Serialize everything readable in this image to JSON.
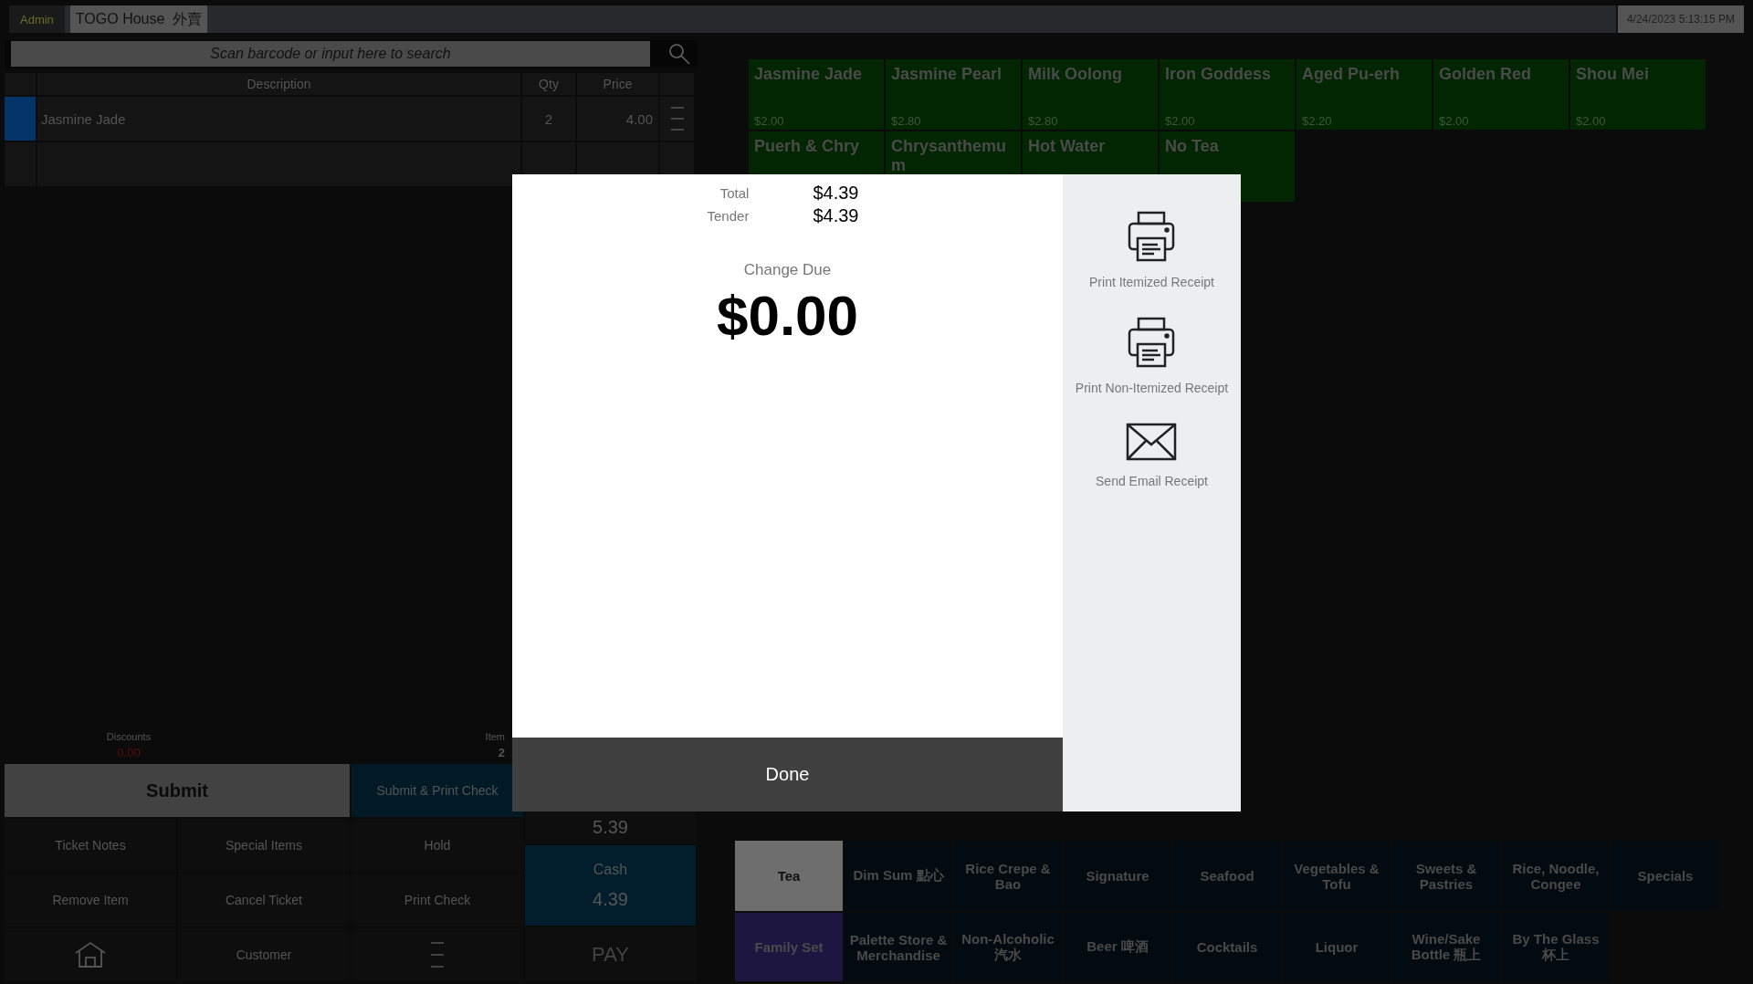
{
  "top_bar": {
    "user": "Admin",
    "order_type": "TOGO House  外賣",
    "datetime": "4/24/2023 5:13:15 PM"
  },
  "search": {
    "placeholder": "Scan barcode or input here to search"
  },
  "order_table": {
    "columns": [
      "Description",
      "Qty",
      "Price"
    ],
    "rows": [
      {
        "description": "Jasmine Jade",
        "qty": "2",
        "price": "4.00",
        "selected": true
      }
    ]
  },
  "summary": {
    "discounts_label": "Discounts",
    "discounts": "0.00",
    "item_count_label": "Item",
    "item_count": "2"
  },
  "actions": [
    {
      "label": "Submit",
      "kind": "primary"
    },
    {
      "label": "Submit & Print Check",
      "kind": "accent"
    },
    {
      "label": "Ticket Notes",
      "kind": "plain"
    },
    {
      "label": "Special Items",
      "kind": "plain"
    },
    {
      "label": "Hold",
      "kind": "plain"
    },
    {
      "label": "Remove Item",
      "kind": "plain"
    },
    {
      "label": "Cancel Ticket",
      "kind": "plain"
    },
    {
      "label": "Print Check",
      "kind": "plain"
    },
    {
      "kind": "home"
    },
    {
      "label": "Customer",
      "kind": "plain"
    },
    {
      "kind": "menu"
    }
  ],
  "balance": "5.39",
  "payment": {
    "label": "Cash",
    "amount": "4.39"
  },
  "pay_button": "PAY",
  "products": [
    {
      "name": "Jasmine Jade",
      "price": "$2.00"
    },
    {
      "name": "Jasmine Pearl",
      "price": "$2.80"
    },
    {
      "name": "Milk Oolong",
      "price": "$2.80"
    },
    {
      "name": "Iron Goddess",
      "price": "$2.00"
    },
    {
      "name": "Aged Pu-erh",
      "price": "$2.20"
    },
    {
      "name": "Golden Red",
      "price": "$2.00"
    },
    {
      "name": "Shou Mei",
      "price": "$2.00"
    },
    {
      "name": "Puerh & Chry"
    },
    {
      "name": "Chrysanthemum"
    },
    {
      "name": "Hot Water"
    },
    {
      "name": "No Tea"
    }
  ],
  "categories": [
    {
      "label": "Tea",
      "selected": true,
      "color": "#6e6e6e"
    },
    {
      "label": "Dim Sum 點心",
      "selected": false,
      "color": "#030a10"
    },
    {
      "label": "Rice Crepe & Bao",
      "selected": false,
      "color": "#030a10"
    },
    {
      "label": "Signature",
      "selected": false,
      "color": "#030a10"
    },
    {
      "label": "Seafood",
      "selected": false,
      "color": "#030a10"
    },
    {
      "label": "Vegetables & Tofu",
      "selected": false,
      "color": "#030a10"
    },
    {
      "label": "Sweets & Pastries",
      "selected": false,
      "color": "#030a10"
    },
    {
      "label": "Rice, Noodle, Congee",
      "selected": false,
      "color": "#030a10"
    },
    {
      "label": "Specials",
      "selected": false,
      "color": "#030a10"
    },
    {
      "label": "Family Set",
      "selected": false,
      "color": "#1c1640"
    },
    {
      "label": "Palette Store & Merchandise",
      "selected": false,
      "color": "#030a10"
    },
    {
      "label": "Non-Alcoholic 汽水",
      "selected": false,
      "color": "#030a10"
    },
    {
      "label": "Beer 啤酒",
      "selected": false,
      "color": "#030a10"
    },
    {
      "label": "Cocktails",
      "selected": false,
      "color": "#030a10"
    },
    {
      "label": "Liquor",
      "selected": false,
      "color": "#030a10"
    },
    {
      "label": "Wine/Sake Bottle 瓶上",
      "selected": false,
      "color": "#030a10"
    },
    {
      "label": "By The Glass 杯上",
      "selected": false,
      "color": "#030a10"
    }
  ],
  "payment_dialog": {
    "total_label": "Total",
    "total": "$4.39",
    "tender_label": "Tender",
    "tender": "$4.39",
    "change_label": "Change Due",
    "change": "$0.00",
    "done_button": "Done",
    "receipt_options": [
      {
        "label": "Print Itemized Receipt",
        "kind": "printer"
      },
      {
        "label": "Print Non-Itemized Receipt",
        "kind": "printer"
      },
      {
        "label": "Send Email Receipt",
        "kind": "email"
      }
    ]
  }
}
